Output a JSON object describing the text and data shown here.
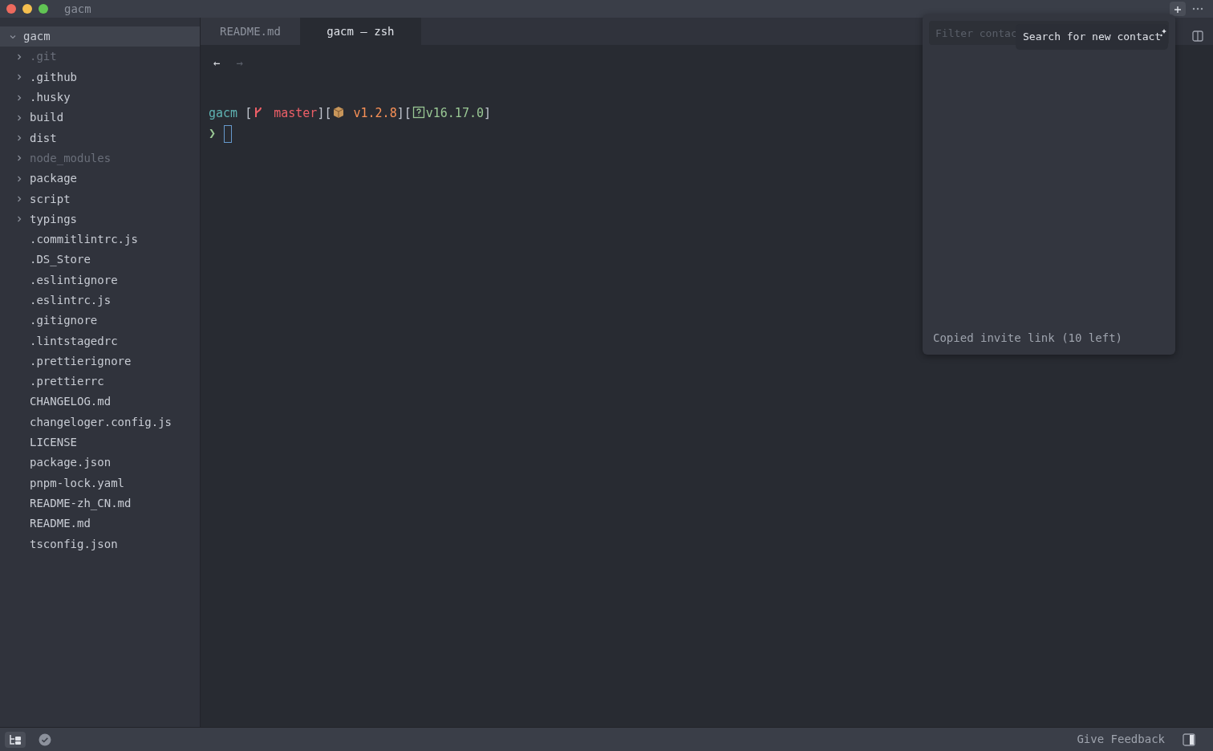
{
  "window": {
    "title": "gacm"
  },
  "sidebar": {
    "root": {
      "label": "gacm",
      "expanded": true,
      "selected": true,
      "children": [
        {
          "label": ".git",
          "kind": "folder",
          "ignored": true
        },
        {
          "label": ".github",
          "kind": "folder",
          "ignored": false
        },
        {
          "label": ".husky",
          "kind": "folder",
          "ignored": false
        },
        {
          "label": "build",
          "kind": "folder",
          "ignored": false
        },
        {
          "label": "dist",
          "kind": "folder",
          "ignored": false
        },
        {
          "label": "node_modules",
          "kind": "folder",
          "ignored": true
        },
        {
          "label": "package",
          "kind": "folder",
          "ignored": false
        },
        {
          "label": "script",
          "kind": "folder",
          "ignored": false
        },
        {
          "label": "typings",
          "kind": "folder",
          "ignored": false
        },
        {
          "label": ".commitlintrc.js",
          "kind": "file",
          "ignored": false
        },
        {
          "label": ".DS_Store",
          "kind": "file",
          "ignored": false
        },
        {
          "label": ".eslintignore",
          "kind": "file",
          "ignored": false
        },
        {
          "label": ".eslintrc.js",
          "kind": "file",
          "ignored": false
        },
        {
          "label": ".gitignore",
          "kind": "file",
          "ignored": false
        },
        {
          "label": ".lintstagedrc",
          "kind": "file",
          "ignored": false
        },
        {
          "label": ".prettierignore",
          "kind": "file",
          "ignored": false
        },
        {
          "label": ".prettierrc",
          "kind": "file",
          "ignored": false
        },
        {
          "label": "CHANGELOG.md",
          "kind": "file",
          "ignored": false
        },
        {
          "label": "changeloger.config.js",
          "kind": "file",
          "ignored": false
        },
        {
          "label": "LICENSE",
          "kind": "file",
          "ignored": false
        },
        {
          "label": "package.json",
          "kind": "file",
          "ignored": false
        },
        {
          "label": "pnpm-lock.yaml",
          "kind": "file",
          "ignored": false
        },
        {
          "label": "README-zh_CN.md",
          "kind": "file",
          "ignored": false
        },
        {
          "label": "README.md",
          "kind": "file",
          "ignored": false
        },
        {
          "label": "tsconfig.json",
          "kind": "file",
          "ignored": false
        }
      ]
    }
  },
  "tabs": [
    {
      "label": "README.md",
      "selected": false
    },
    {
      "label": "gacm — zsh",
      "selected": true
    }
  ],
  "nav": {
    "back": {
      "label": "←",
      "disabled": false
    },
    "forward": {
      "label": "→",
      "disabled": true
    }
  },
  "terminal": {
    "prompt_line": [
      {
        "kind": "text",
        "text": "gacm",
        "color": "#5fb3b3"
      },
      {
        "kind": "text",
        "text": " [",
        "color": "#c0c5ce"
      },
      {
        "kind": "branch",
        "color": "#ec5f67"
      },
      {
        "kind": "text",
        "text": " master",
        "color": "#ec5f67"
      },
      {
        "kind": "text",
        "text": "][",
        "color": "#c0c5ce"
      },
      {
        "kind": "package",
        "color": "#c8965a"
      },
      {
        "kind": "text",
        "text": " v1.2.8",
        "color": "#f99157"
      },
      {
        "kind": "text",
        "text": "][",
        "color": "#c0c5ce"
      },
      {
        "kind": "unknown",
        "color": "#99c794"
      },
      {
        "kind": "text",
        "text": "v16.17.0",
        "color": "#99c794"
      },
      {
        "kind": "text",
        "text": "]",
        "color": "#c0c5ce"
      }
    ],
    "prompt": "❯"
  },
  "contacts_popover": {
    "filter": {
      "placeholder": "Filter contac"
    },
    "tooltip": "Search for new contact",
    "status": "Copied invite link (10 left)"
  },
  "status_bar": {
    "feedback": "Give Feedback"
  }
}
